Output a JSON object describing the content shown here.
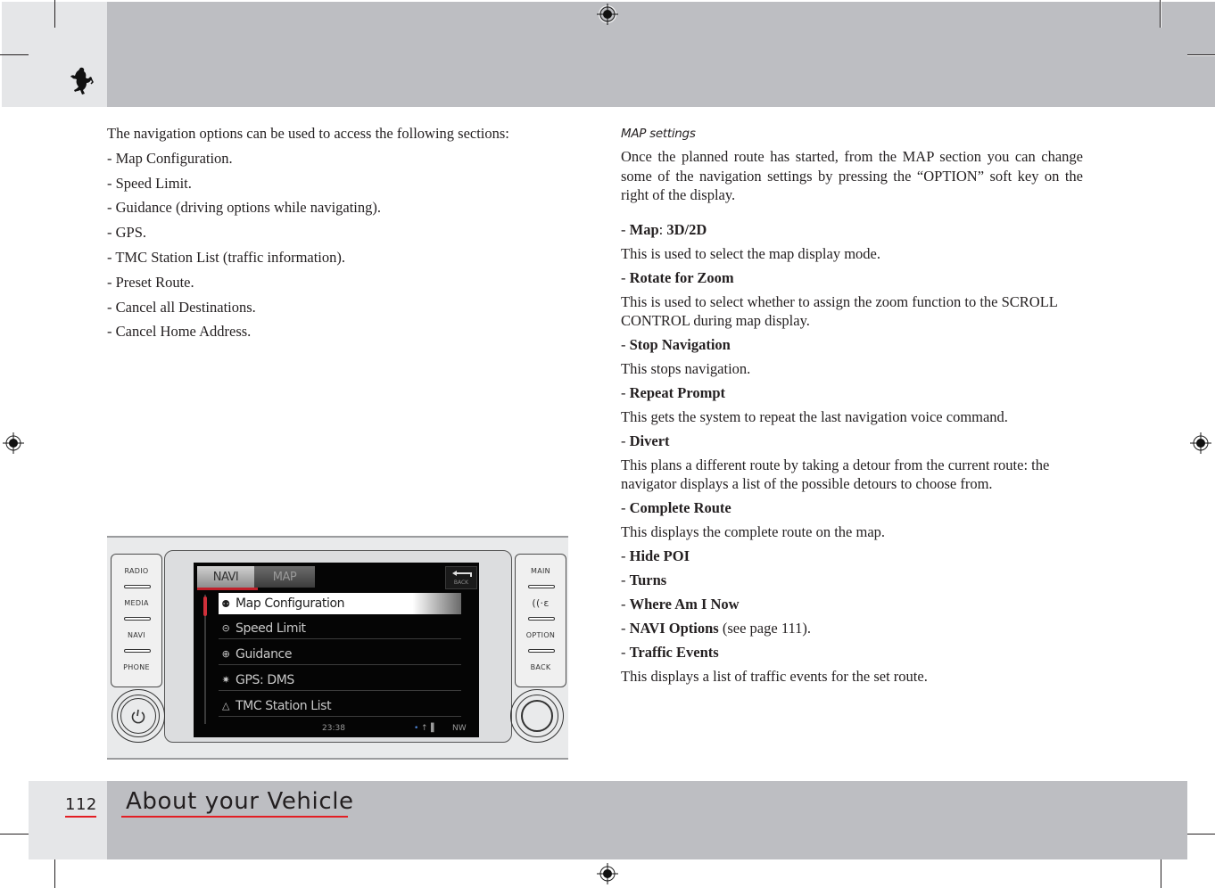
{
  "page": {
    "number": "112",
    "section_title": "About your Vehicle"
  },
  "left_column": {
    "intro": "The navigation options can be used to access the following sections:",
    "items": [
      "- Map Configuration.",
      "- Speed Limit.",
      "- Guidance (driving options while navigating).",
      "- GPS.",
      "- TMC Station List (traffic information).",
      "- Preset Route.",
      "- Cancel all Destinations.",
      "- Cancel Home Address."
    ]
  },
  "right_column": {
    "subheading": "MAP settings",
    "intro": "Once the planned route has started, from the MAP section you can change some of the navigation settings by pressing the “OPTION” soft key on the right of the display.",
    "options": [
      {
        "prefix": "- ",
        "label": "Map",
        "sep": ": ",
        "value": "3D/2D",
        "suffix": "",
        "description": "This is used to select the map display mode."
      },
      {
        "prefix": "- ",
        "label": "Rotate for Zoom",
        "sep": "",
        "value": "",
        "suffix": "",
        "description": "This is used to select whether to assign the zoom function to the SCROLL CONTROL during map display."
      },
      {
        "prefix": "- ",
        "label": "Stop Navigation",
        "sep": "",
        "value": "",
        "suffix": "",
        "description": "This stops navigation."
      },
      {
        "prefix": "- ",
        "label": "Repeat Prompt",
        "sep": "",
        "value": "",
        "suffix": "",
        "description": "This gets the system to repeat the last navigation voice command."
      },
      {
        "prefix": "- ",
        "label": "Divert",
        "sep": "",
        "value": "",
        "suffix": "",
        "description": "This plans a different route by taking a detour from the current route: the navigator displays a list of the possible detours to choose from."
      },
      {
        "prefix": "- ",
        "label": "Complete Route",
        "sep": "",
        "value": "",
        "suffix": "",
        "description": "This displays the complete route on the map."
      },
      {
        "prefix": "- ",
        "label": "Hide POI",
        "sep": "",
        "value": "",
        "suffix": "",
        "description": ""
      },
      {
        "prefix": "- ",
        "label": "Turns",
        "sep": "",
        "value": "",
        "suffix": "",
        "description": ""
      },
      {
        "prefix": "- ",
        "label": "Where Am I Now",
        "sep": "",
        "value": "",
        "suffix": "",
        "description": ""
      },
      {
        "prefix": "- ",
        "label": "NAVI Options",
        "sep": "",
        "value": "",
        "suffix": " (see page 111).",
        "description": ""
      },
      {
        "prefix": "- ",
        "label": "Traffic Events",
        "sep": "",
        "value": "",
        "suffix": "",
        "description": "This displays a list of traffic events for the set route."
      }
    ]
  },
  "device": {
    "left_buttons": [
      "RADIO",
      "MEDIA",
      "NAVI",
      "PHONE"
    ],
    "right_buttons": [
      "MAIN",
      "voice-icon",
      "OPTION",
      "BACK"
    ],
    "screen": {
      "tabs": [
        "NAVI",
        "MAP"
      ],
      "active_tab": "NAVI",
      "back_label": "BACK",
      "menu": [
        {
          "icon": "map-config-icon",
          "glyph": "⚉",
          "label": "Map Configuration",
          "selected": true
        },
        {
          "icon": "speed-limit-icon",
          "glyph": "⊝",
          "label": "Speed Limit",
          "selected": false
        },
        {
          "icon": "guidance-icon",
          "glyph": "⊕",
          "label": "Guidance",
          "selected": false
        },
        {
          "icon": "gps-satellite-icon",
          "glyph": "✷",
          "label": "GPS: DMS",
          "selected": false
        },
        {
          "icon": "tmc-warning-icon",
          "glyph": "△",
          "label": "TMC Station List",
          "selected": false
        }
      ],
      "status": {
        "time": "23:38",
        "bluetooth": "•",
        "signal": "↑▐",
        "heading": "NW"
      }
    }
  },
  "colors": {
    "accent_red": "#e31e24",
    "band_light": "#e5e6e8",
    "band_dark": "#bdbec2"
  }
}
